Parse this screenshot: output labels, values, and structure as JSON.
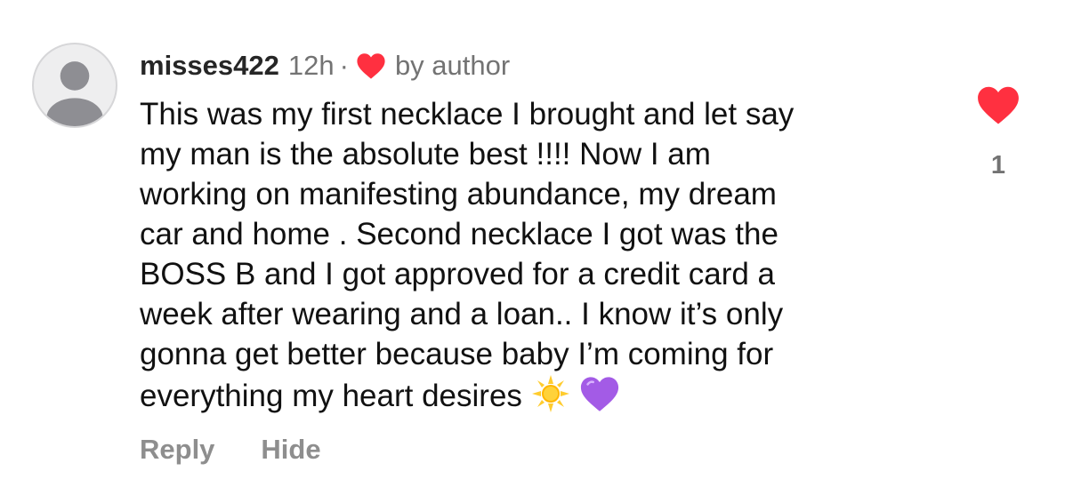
{
  "comment": {
    "avatar_icon": "default-user-avatar-icon",
    "username": "misses422",
    "time": "12h",
    "separator": "·",
    "liked_by_author_icon": "red-heart-icon",
    "liked_by_author_label": "by author",
    "text_lines": [
      "This was my first necklace I brought and let say",
      "my man is the absolute best !!!! Now I am",
      "working on manifesting abundance, my dream",
      "car and home . Second necklace I got was the",
      "BOSS B and I got approved for a credit card a",
      "week after wearing and a loan.. I know it’s only",
      "gonna get better because baby I’m coming for",
      "everything my heart desires"
    ],
    "emojis": [
      "sun-emoji",
      "purple-heart-emoji"
    ],
    "actions": {
      "reply_label": "Reply",
      "hide_label": "Hide"
    },
    "like": {
      "icon": "red-heart-icon",
      "liked": true,
      "count": "1"
    }
  },
  "colors": {
    "heart_red": "#ff3040",
    "secondary_text": "#737373",
    "action_text": "#8e8e8e",
    "emoji_purple": "#a35be6",
    "emoji_sun": "#ffcc2e"
  }
}
